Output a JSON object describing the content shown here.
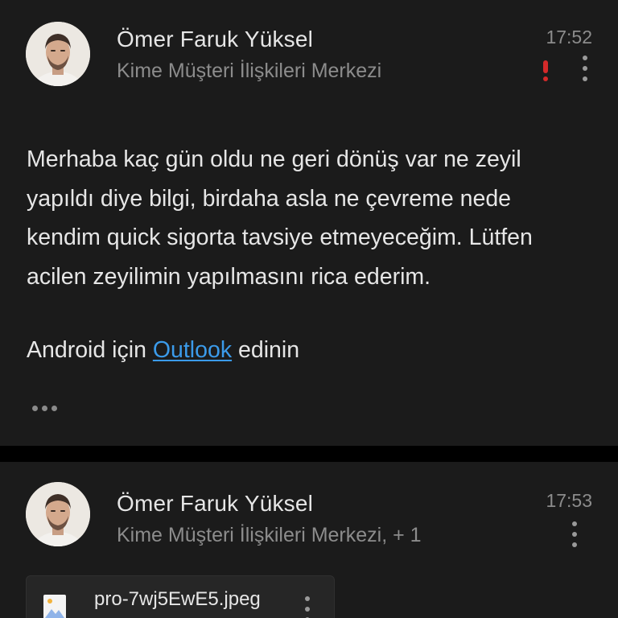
{
  "messages": [
    {
      "sender": "Ömer Faruk Yüksel",
      "recipient": "Kime Müşteri İlişkileri Merkezi",
      "time": "17:52",
      "flagged_important": true,
      "body": [
        "Merhaba kaç gün oldu ne geri dönüş var ne zeyil yapıldı diye bilgi, birdaha asla ne çevreme nede kendim quick sigorta tavsiye etmeyeceğim. Lütfen acilen zeyilimin yapılmasını rica ederim."
      ],
      "signature": {
        "prefix": "Android için",
        "link_text": "Outlook",
        "suffix": "edinin"
      }
    },
    {
      "sender": "Ömer Faruk Yüksel",
      "recipient": "Kime Müşteri İlişkileri Merkezi, + 1",
      "time": "17:53",
      "attachment": {
        "file_name": "pro-7wj5EwE5.jpeg",
        "icon": "image-file-icon"
      }
    }
  ],
  "icons": {
    "avatar": "avatar",
    "importance": "exclamation-icon",
    "more": "more-vert-icon",
    "expand": "more-horiz-icon"
  },
  "colors": {
    "background": "#000000",
    "card": "#1b1b1b",
    "primary_text": "#e6e6e6",
    "secondary_text": "#8c8c8c",
    "link": "#3b9bea",
    "importance": "#d42a2a"
  }
}
